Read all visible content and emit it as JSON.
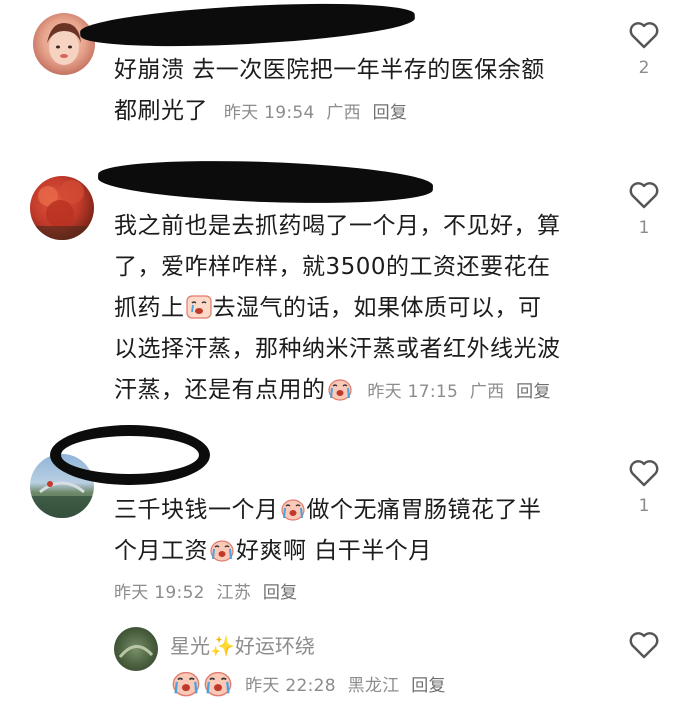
{
  "comments": [
    {
      "text_lines": [
        "好崩溃 去一次医院把一年半存的医保余额",
        "都刷光了"
      ],
      "time": "昨天 19:54",
      "location": "广西",
      "reply": "回复",
      "likes": "2"
    },
    {
      "text_lines": [
        "我之前也是去抓药喝了一个月，不见好，算",
        "了，爱咋样咋样，就3500的工资还要花在",
        "抓药上",
        "去湿气的话，如果体质可以，可",
        "以选择汗蒸，那种纳米汗蒸或者红外线光波",
        "汗蒸，还是有点用的"
      ],
      "time": "昨天 17:15",
      "location": "广西",
      "reply": "回复",
      "likes": "1"
    },
    {
      "text_parts": [
        "三千块钱一个月",
        "做个无痛胃肠镜花了半",
        "个月工资",
        "好爽啊 白干半个月"
      ],
      "time": "昨天 19:52",
      "location": "江苏",
      "reply": "回复",
      "likes": "1"
    }
  ],
  "sub_reply": {
    "name_part1": "星光",
    "sparkle": "✨",
    "name_part2": "好运环绕",
    "time": "昨天 22:28",
    "location": "黑龙江",
    "reply": "回复"
  },
  "icons": {
    "like": "heart-outline-icon",
    "sparkle": "sparkles-icon"
  },
  "colors": {
    "meta": "#8c8c8c",
    "text": "#1c1c1c",
    "redaction": "#0c0c0c"
  }
}
